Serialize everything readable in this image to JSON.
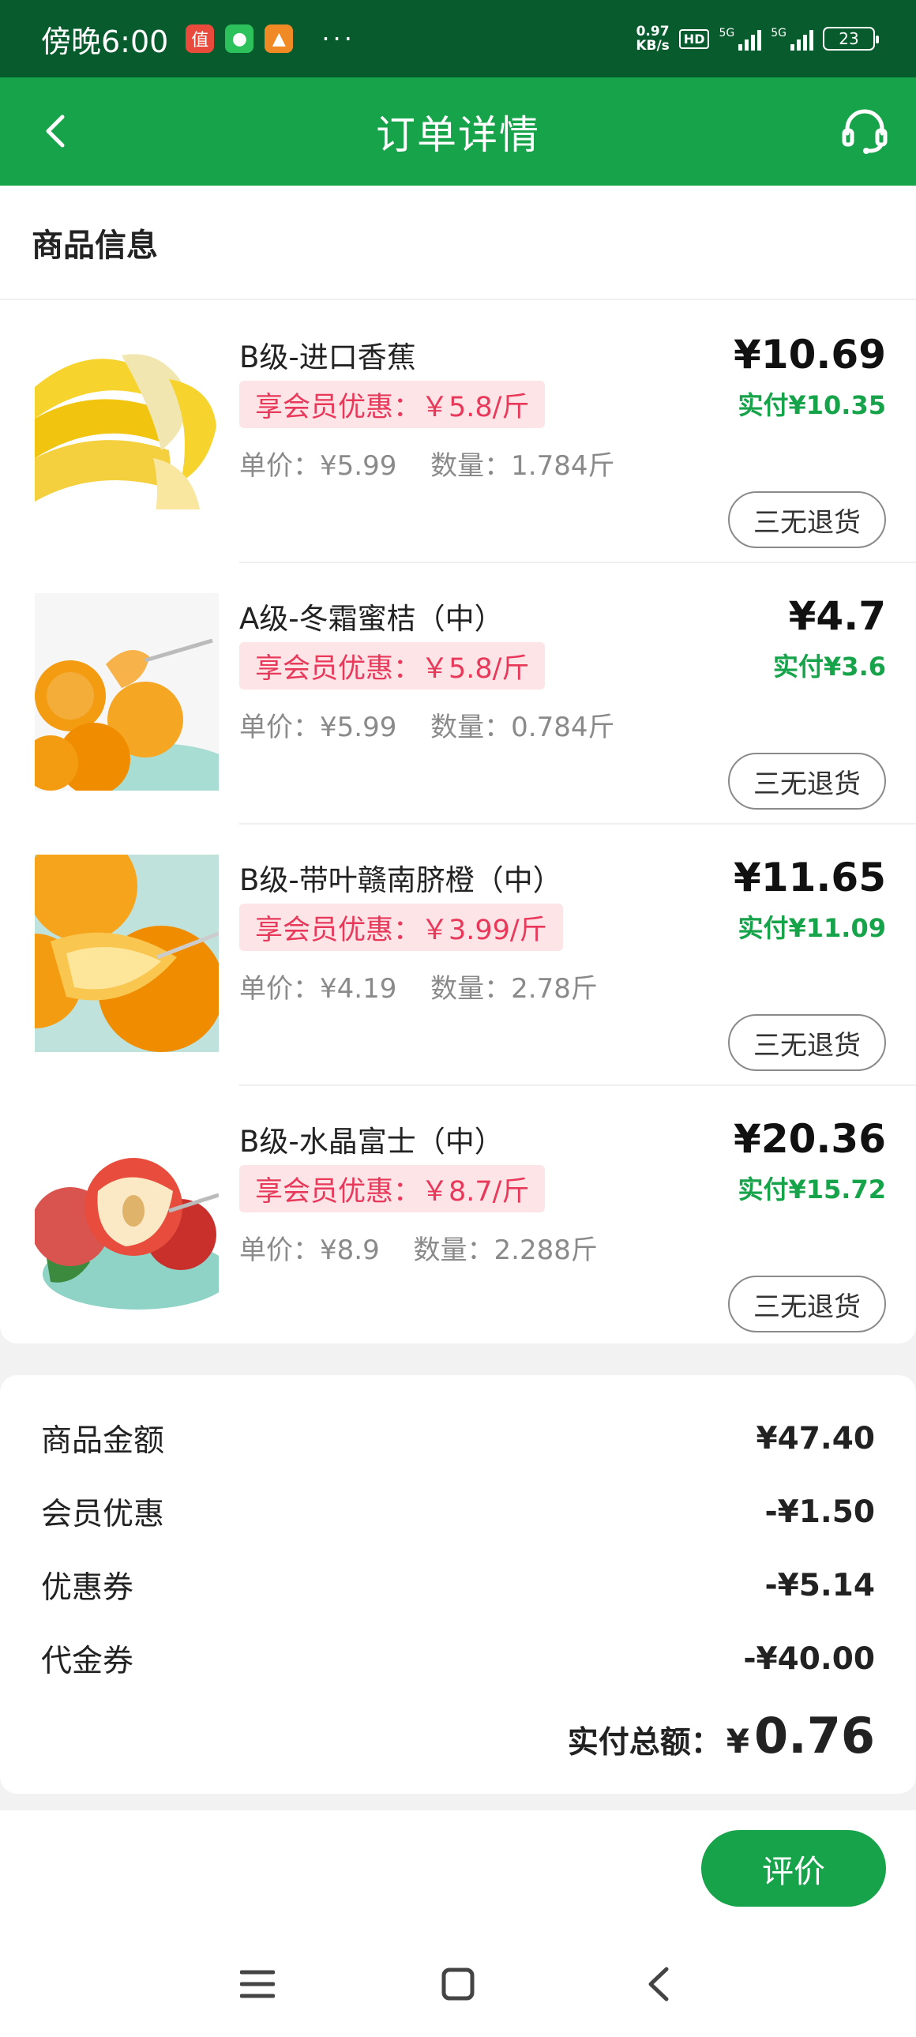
{
  "status_bar": {
    "time": "傍晚6:00",
    "net_speed_value": "0.97",
    "net_speed_unit": "KB/s",
    "hd_label": "HD",
    "sig1_label": "5G",
    "sig2_label": "5G",
    "battery": "23",
    "more": "···"
  },
  "header": {
    "title": "订单详情"
  },
  "products": {
    "section_title": "商品信息",
    "unit_label": "单价：",
    "qty_label": "数量：",
    "return_label": "三无退货",
    "items": [
      {
        "name": "B级-进口香蕉",
        "promo": "享会员优惠：￥5.8/斤",
        "unit_price": "¥5.99",
        "quantity": "1.784斤",
        "price": "¥10.69",
        "paid": "实付¥10.35",
        "image": "banana"
      },
      {
        "name": "A级-冬霜蜜桔（中）",
        "promo": "享会员优惠：￥5.8/斤",
        "unit_price": "¥5.99",
        "quantity": "0.784斤",
        "price": "¥4.7",
        "paid": "实付¥3.6",
        "image": "tangerine"
      },
      {
        "name": "B级-带叶赣南脐橙（中）",
        "promo": "享会员优惠：￥3.99/斤",
        "unit_price": "¥4.19",
        "quantity": "2.78斤",
        "price": "¥11.65",
        "paid": "实付¥11.09",
        "image": "orange"
      },
      {
        "name": "B级-水晶富士（中）",
        "promo": "享会员优惠：￥8.7/斤",
        "unit_price": "¥8.9",
        "quantity": "2.288斤",
        "price": "¥20.36",
        "paid": "实付¥15.72",
        "image": "apple"
      }
    ]
  },
  "summary": {
    "rows": [
      {
        "label": "商品金额",
        "value": "¥47.40"
      },
      {
        "label": "会员优惠",
        "value": "-¥1.50"
      },
      {
        "label": "优惠券",
        "value": "-¥5.14"
      },
      {
        "label": "代金券",
        "value": "-¥40.00"
      }
    ],
    "total_label": "实付总额：",
    "total_currency": "¥",
    "total_amount": "0.76"
  },
  "actions": {
    "review_label": "评价"
  },
  "colors": {
    "brand_green": "#16a34a",
    "status_bar": "#075b2d",
    "promo_text": "#e8395a",
    "promo_bg": "#fde4e7"
  },
  "icons": {
    "back": "chevron-left-icon",
    "service": "headset-icon",
    "nav_menu": "menu-icon",
    "nav_home": "home-square-icon",
    "nav_back": "back-triangle-icon"
  }
}
